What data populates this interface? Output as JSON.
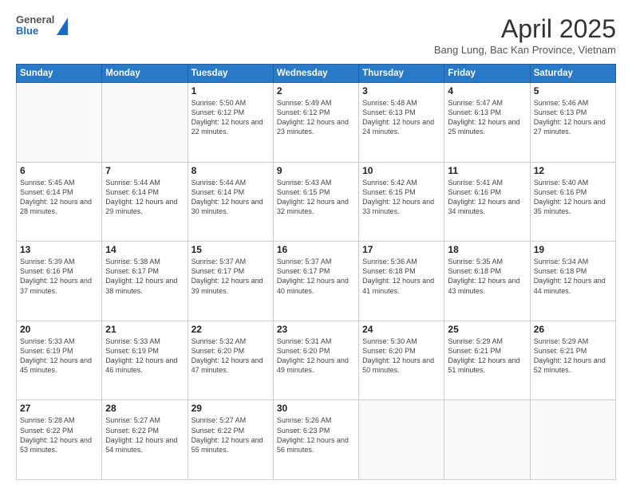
{
  "header": {
    "logo": {
      "line1": "General",
      "line2": "Blue"
    },
    "title": "April 2025",
    "location": "Bang Lung, Bac Kan Province, Vietnam"
  },
  "weekdays": [
    "Sunday",
    "Monday",
    "Tuesday",
    "Wednesday",
    "Thursday",
    "Friday",
    "Saturday"
  ],
  "weeks": [
    [
      {
        "day": null
      },
      {
        "day": null
      },
      {
        "day": "1",
        "sunrise": "5:50 AM",
        "sunset": "6:12 PM",
        "daylight": "12 hours and 22 minutes."
      },
      {
        "day": "2",
        "sunrise": "5:49 AM",
        "sunset": "6:12 PM",
        "daylight": "12 hours and 23 minutes."
      },
      {
        "day": "3",
        "sunrise": "5:48 AM",
        "sunset": "6:13 PM",
        "daylight": "12 hours and 24 minutes."
      },
      {
        "day": "4",
        "sunrise": "5:47 AM",
        "sunset": "6:13 PM",
        "daylight": "12 hours and 25 minutes."
      },
      {
        "day": "5",
        "sunrise": "5:46 AM",
        "sunset": "6:13 PM",
        "daylight": "12 hours and 27 minutes."
      }
    ],
    [
      {
        "day": "6",
        "sunrise": "5:45 AM",
        "sunset": "6:14 PM",
        "daylight": "12 hours and 28 minutes."
      },
      {
        "day": "7",
        "sunrise": "5:44 AM",
        "sunset": "6:14 PM",
        "daylight": "12 hours and 29 minutes."
      },
      {
        "day": "8",
        "sunrise": "5:44 AM",
        "sunset": "6:14 PM",
        "daylight": "12 hours and 30 minutes."
      },
      {
        "day": "9",
        "sunrise": "5:43 AM",
        "sunset": "6:15 PM",
        "daylight": "12 hours and 32 minutes."
      },
      {
        "day": "10",
        "sunrise": "5:42 AM",
        "sunset": "6:15 PM",
        "daylight": "12 hours and 33 minutes."
      },
      {
        "day": "11",
        "sunrise": "5:41 AM",
        "sunset": "6:16 PM",
        "daylight": "12 hours and 34 minutes."
      },
      {
        "day": "12",
        "sunrise": "5:40 AM",
        "sunset": "6:16 PM",
        "daylight": "12 hours and 35 minutes."
      }
    ],
    [
      {
        "day": "13",
        "sunrise": "5:39 AM",
        "sunset": "6:16 PM",
        "daylight": "12 hours and 37 minutes."
      },
      {
        "day": "14",
        "sunrise": "5:38 AM",
        "sunset": "6:17 PM",
        "daylight": "12 hours and 38 minutes."
      },
      {
        "day": "15",
        "sunrise": "5:37 AM",
        "sunset": "6:17 PM",
        "daylight": "12 hours and 39 minutes."
      },
      {
        "day": "16",
        "sunrise": "5:37 AM",
        "sunset": "6:17 PM",
        "daylight": "12 hours and 40 minutes."
      },
      {
        "day": "17",
        "sunrise": "5:36 AM",
        "sunset": "6:18 PM",
        "daylight": "12 hours and 41 minutes."
      },
      {
        "day": "18",
        "sunrise": "5:35 AM",
        "sunset": "6:18 PM",
        "daylight": "12 hours and 43 minutes."
      },
      {
        "day": "19",
        "sunrise": "5:34 AM",
        "sunset": "6:18 PM",
        "daylight": "12 hours and 44 minutes."
      }
    ],
    [
      {
        "day": "20",
        "sunrise": "5:33 AM",
        "sunset": "6:19 PM",
        "daylight": "12 hours and 45 minutes."
      },
      {
        "day": "21",
        "sunrise": "5:33 AM",
        "sunset": "6:19 PM",
        "daylight": "12 hours and 46 minutes."
      },
      {
        "day": "22",
        "sunrise": "5:32 AM",
        "sunset": "6:20 PM",
        "daylight": "12 hours and 47 minutes."
      },
      {
        "day": "23",
        "sunrise": "5:31 AM",
        "sunset": "6:20 PM",
        "daylight": "12 hours and 49 minutes."
      },
      {
        "day": "24",
        "sunrise": "5:30 AM",
        "sunset": "6:20 PM",
        "daylight": "12 hours and 50 minutes."
      },
      {
        "day": "25",
        "sunrise": "5:29 AM",
        "sunset": "6:21 PM",
        "daylight": "12 hours and 51 minutes."
      },
      {
        "day": "26",
        "sunrise": "5:29 AM",
        "sunset": "6:21 PM",
        "daylight": "12 hours and 52 minutes."
      }
    ],
    [
      {
        "day": "27",
        "sunrise": "5:28 AM",
        "sunset": "6:22 PM",
        "daylight": "12 hours and 53 minutes."
      },
      {
        "day": "28",
        "sunrise": "5:27 AM",
        "sunset": "6:22 PM",
        "daylight": "12 hours and 54 minutes."
      },
      {
        "day": "29",
        "sunrise": "5:27 AM",
        "sunset": "6:22 PM",
        "daylight": "12 hours and 55 minutes."
      },
      {
        "day": "30",
        "sunrise": "5:26 AM",
        "sunset": "6:23 PM",
        "daylight": "12 hours and 56 minutes."
      },
      {
        "day": null
      },
      {
        "day": null
      },
      {
        "day": null
      }
    ]
  ]
}
